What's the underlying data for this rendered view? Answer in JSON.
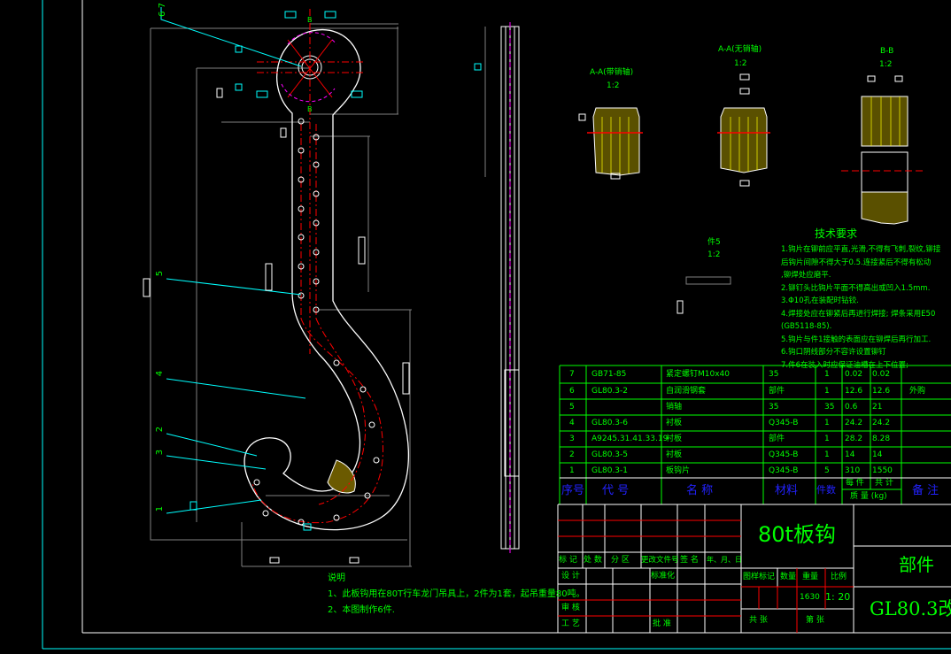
{
  "drawing": {
    "colors": {
      "background": "#000000",
      "outline": "#ffffff",
      "centerline": "#ff0000",
      "dimension": "#808080",
      "annotation": "#00ffff",
      "text": "#00ff00",
      "header": "#2222ff",
      "hatch": "#ffff00"
    },
    "section_views": [
      {
        "title": "A-A(带销轴)",
        "scale": "1:2"
      },
      {
        "title": "A-A(无销轴)",
        "scale": "1:2"
      },
      {
        "title": "B-B",
        "scale": "1:2"
      },
      {
        "title": "件5",
        "scale": "1:2"
      }
    ],
    "section_marks": [
      "B",
      "B"
    ],
    "balloons": [
      "1",
      "2",
      "3",
      "4",
      "5",
      "6",
      "7"
    ],
    "tech_requirements": {
      "title": "技术要求",
      "items": [
        "1.钩片在铆前应平直,光滑,不得有飞刺,裂纹,铆接",
        "后钩片间隙不得大于0.5.连接紧后不得有松动",
        ",铆焊处应磨平.",
        "2.铆钉头比钩片平面不得高出或凹入1.5mm.",
        "3.Φ10孔在装配时钻铰.",
        "4.焊接处应在铆紧后再进行焊接; 焊条采用E50",
        "(GB5118-85).",
        "5.钩片与件1接触的表面应在铆焊后再行加工.",
        "6.钩口阴线部分不容许设置铆钉",
        "7.件6在装入时应保证油槽在上下位置;"
      ]
    },
    "notes": {
      "title": "说明",
      "items": [
        "1、此板钩用在80T行车龙门吊具上，2件为1套，起吊重量80吨。",
        "2、本图制作6件."
      ]
    }
  },
  "bom": {
    "rows": [
      {
        "no": "7",
        "code": "GB71-85",
        "name": "紧定螺钉M10x40",
        "material": "35",
        "qty": "1",
        "unit": "0.02",
        "total": "0.02",
        "remark": ""
      },
      {
        "no": "6",
        "code": "GL80.3-2",
        "name": "自润滑钢套",
        "material": "部件",
        "qty": "1",
        "unit": "12.6",
        "total": "12.6",
        "remark": "外购"
      },
      {
        "no": "5",
        "code": "",
        "name": "销轴",
        "material": "35",
        "qty": "35",
        "unit": "0.6",
        "total": "21",
        "remark": ""
      },
      {
        "no": "4",
        "code": "GL80.3-6",
        "name": "衬板",
        "material": "Q345-B",
        "qty": "1",
        "unit": "24.2",
        "total": "24.2",
        "remark": ""
      },
      {
        "no": "3",
        "code": "A9245.31.41.33.19",
        "name": "衬板",
        "material": "部件",
        "qty": "1",
        "unit": "28.2",
        "total": "8.28",
        "remark": ""
      },
      {
        "no": "2",
        "code": "GL80.3-5",
        "name": "衬板",
        "material": "Q345-B",
        "qty": "1",
        "unit": "14",
        "total": "14",
        "remark": ""
      },
      {
        "no": "1",
        "code": "GL80.3-1",
        "name": "板钩片",
        "material": "Q345-B",
        "qty": "5",
        "unit": "310",
        "total": "1550",
        "remark": ""
      }
    ],
    "header": {
      "no": "序号",
      "code": "代  号",
      "name": "名    称",
      "material": "材料",
      "qty": "件数",
      "unit": "每 件",
      "total": "共 计",
      "mass": "质 量 (kg)",
      "remark": "备  注"
    }
  },
  "title_block": {
    "title": "80t板钩",
    "type": "部件",
    "drawing_no": "GL80.3改",
    "rev_headers": [
      "标 记",
      "处 数",
      "分  区",
      "更改文件号",
      "签  名",
      "年、月、日"
    ],
    "roles": [
      "设 计",
      "审 核",
      "工 艺"
    ],
    "std": "标准化",
    "approve": "批 准",
    "stage_label": "图样标记",
    "qty_label": "数量",
    "weight_label": "重量",
    "scale_label": "比例",
    "weight": "1630",
    "scale": "1: 20",
    "sheets_total": "共    张",
    "sheet_no": "第    张"
  }
}
